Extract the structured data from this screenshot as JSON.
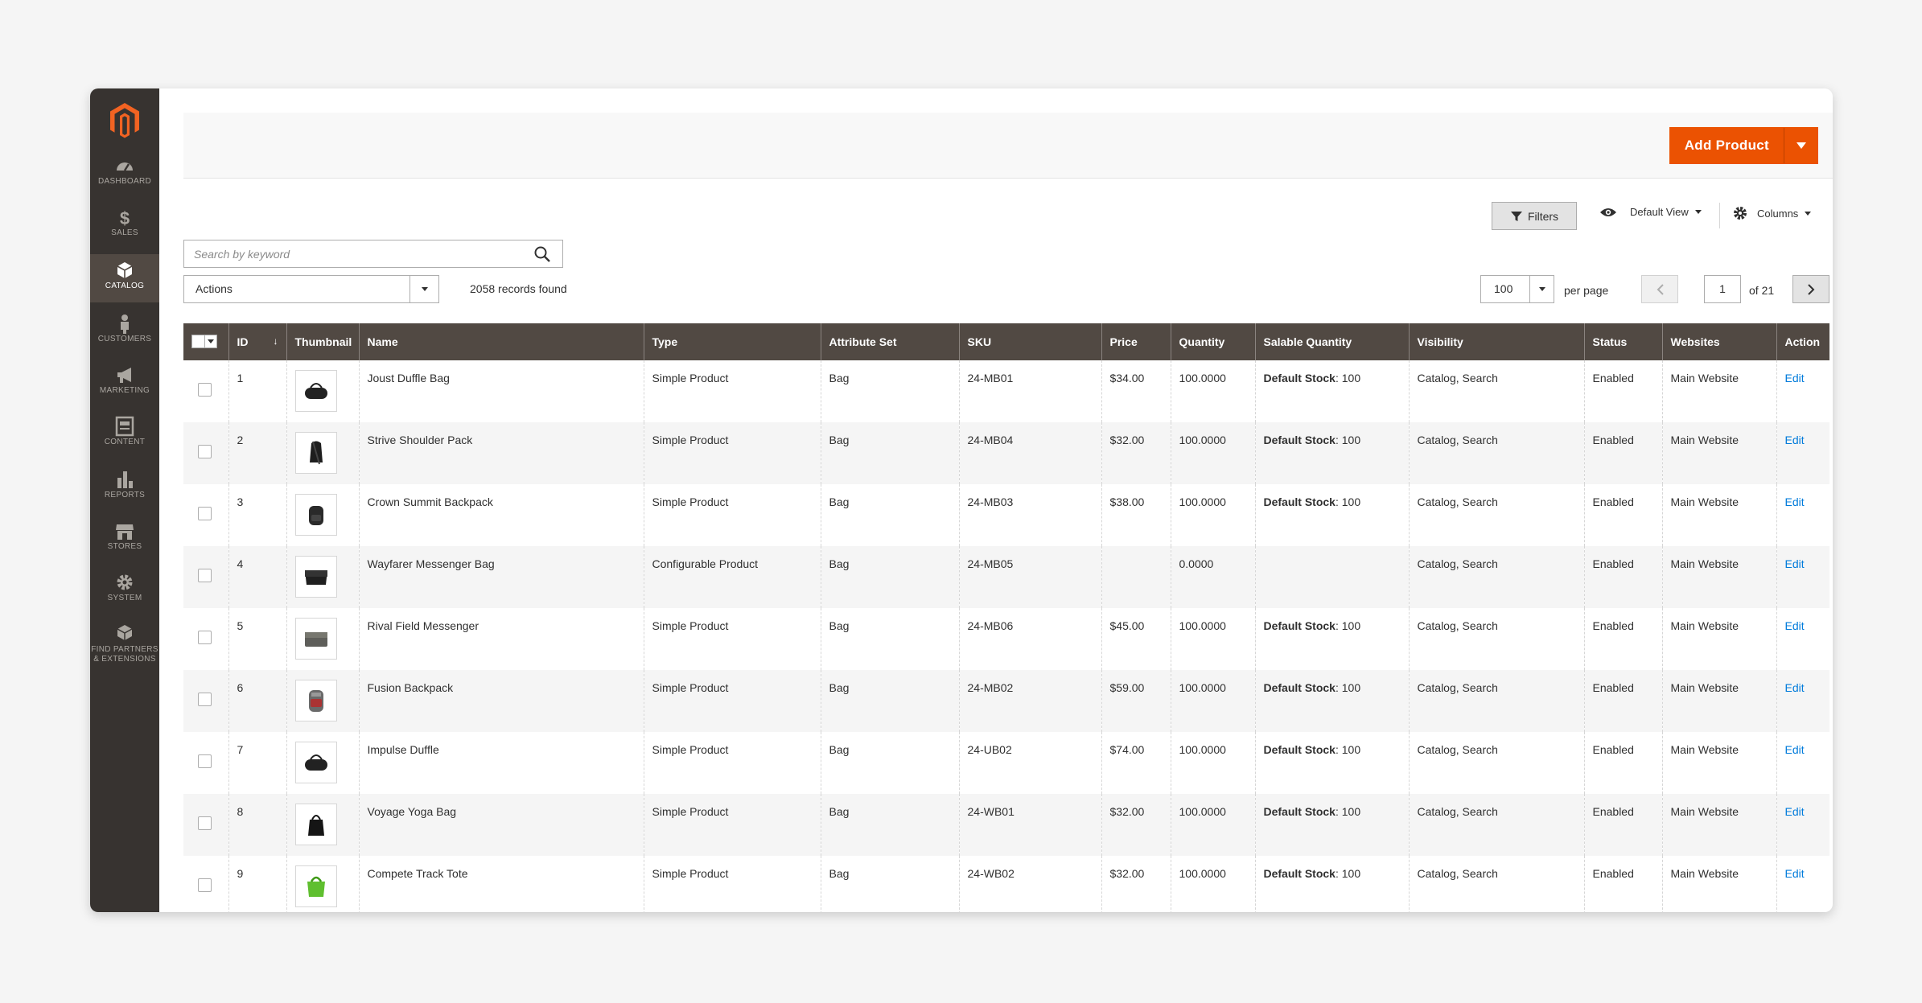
{
  "sidebar": {
    "items": [
      {
        "label": "Dashboard",
        "icon": "dashboard-icon"
      },
      {
        "label": "Sales",
        "icon": "dollar-icon"
      },
      {
        "label": "Catalog",
        "icon": "cube-icon"
      },
      {
        "label": "Customers",
        "icon": "person-icon"
      },
      {
        "label": "Marketing",
        "icon": "megaphone-icon"
      },
      {
        "label": "Content",
        "icon": "content-icon"
      },
      {
        "label": "Reports",
        "icon": "bar-chart-icon"
      },
      {
        "label": "Stores",
        "icon": "store-icon"
      },
      {
        "label": "System",
        "icon": "gear-icon"
      },
      {
        "label": "Find Partners & Extensions",
        "icon": "boxes-icon"
      }
    ],
    "active": "Catalog"
  },
  "header": {
    "add_product_label": "Add Product"
  },
  "toolbar": {
    "filters_label": "Filters",
    "view_label": "Default View",
    "columns_label": "Columns",
    "search_placeholder": "Search by keyword",
    "actions_label": "Actions",
    "records_found": "2058 records found",
    "per_page_value": "100",
    "per_page_label": "per page",
    "current_page": "1",
    "page_of": "of 21"
  },
  "grid": {
    "columns": [
      "ID",
      "Thumbnail",
      "Name",
      "Type",
      "Attribute Set",
      "SKU",
      "Price",
      "Quantity",
      "Salable Quantity",
      "Visibility",
      "Status",
      "Websites",
      "Action"
    ],
    "stock_label": "Default Stock",
    "rows": [
      {
        "id": "1",
        "name": "Joust Duffle Bag",
        "type": "Simple Product",
        "attribute_set": "Bag",
        "sku": "24-MB01",
        "price": "$34.00",
        "quantity": "100.0000",
        "salable": ": 100",
        "visibility": "Catalog, Search",
        "status": "Enabled",
        "websites": "Main Website",
        "action": "Edit",
        "thumb": "duffle"
      },
      {
        "id": "2",
        "name": "Strive Shoulder Pack",
        "type": "Simple Product",
        "attribute_set": "Bag",
        "sku": "24-MB04",
        "price": "$32.00",
        "quantity": "100.0000",
        "salable": ": 100",
        "visibility": "Catalog, Search",
        "status": "Enabled",
        "websites": "Main Website",
        "action": "Edit",
        "thumb": "shoulder"
      },
      {
        "id": "3",
        "name": "Crown Summit Backpack",
        "type": "Simple Product",
        "attribute_set": "Bag",
        "sku": "24-MB03",
        "price": "$38.00",
        "quantity": "100.0000",
        "salable": ": 100",
        "visibility": "Catalog, Search",
        "status": "Enabled",
        "websites": "Main Website",
        "action": "Edit",
        "thumb": "backpack"
      },
      {
        "id": "4",
        "name": "Wayfarer Messenger Bag",
        "type": "Configurable Product",
        "attribute_set": "Bag",
        "sku": "24-MB05",
        "price": "",
        "quantity": "0.0000",
        "salable": "",
        "visibility": "Catalog, Search",
        "status": "Enabled",
        "websites": "Main Website",
        "action": "Edit",
        "thumb": "messenger"
      },
      {
        "id": "5",
        "name": "Rival Field Messenger",
        "type": "Simple Product",
        "attribute_set": "Bag",
        "sku": "24-MB06",
        "price": "$45.00",
        "quantity": "100.0000",
        "salable": ": 100",
        "visibility": "Catalog, Search",
        "status": "Enabled",
        "websites": "Main Website",
        "action": "Edit",
        "thumb": "field"
      },
      {
        "id": "6",
        "name": "Fusion Backpack",
        "type": "Simple Product",
        "attribute_set": "Bag",
        "sku": "24-MB02",
        "price": "$59.00",
        "quantity": "100.0000",
        "salable": ": 100",
        "visibility": "Catalog, Search",
        "status": "Enabled",
        "websites": "Main Website",
        "action": "Edit",
        "thumb": "fusion"
      },
      {
        "id": "7",
        "name": "Impulse Duffle",
        "type": "Simple Product",
        "attribute_set": "Bag",
        "sku": "24-UB02",
        "price": "$74.00",
        "quantity": "100.0000",
        "salable": ": 100",
        "visibility": "Catalog, Search",
        "status": "Enabled",
        "websites": "Main Website",
        "action": "Edit",
        "thumb": "duffle"
      },
      {
        "id": "8",
        "name": "Voyage Yoga Bag",
        "type": "Simple Product",
        "attribute_set": "Bag",
        "sku": "24-WB01",
        "price": "$32.00",
        "quantity": "100.0000",
        "salable": ": 100",
        "visibility": "Catalog, Search",
        "status": "Enabled",
        "websites": "Main Website",
        "action": "Edit",
        "thumb": "tote"
      },
      {
        "id": "9",
        "name": "Compete Track Tote",
        "type": "Simple Product",
        "attribute_set": "Bag",
        "sku": "24-WB02",
        "price": "$32.00",
        "quantity": "100.0000",
        "salable": ": 100",
        "visibility": "Catalog, Search",
        "status": "Enabled",
        "websites": "Main Website",
        "action": "Edit",
        "thumb": "green-tote"
      }
    ]
  },
  "colors": {
    "sidebar_bg": "#373330",
    "sidebar_active": "#514943",
    "header_bg": "#514943",
    "accent": "#eb5202",
    "link": "#007bdb"
  }
}
